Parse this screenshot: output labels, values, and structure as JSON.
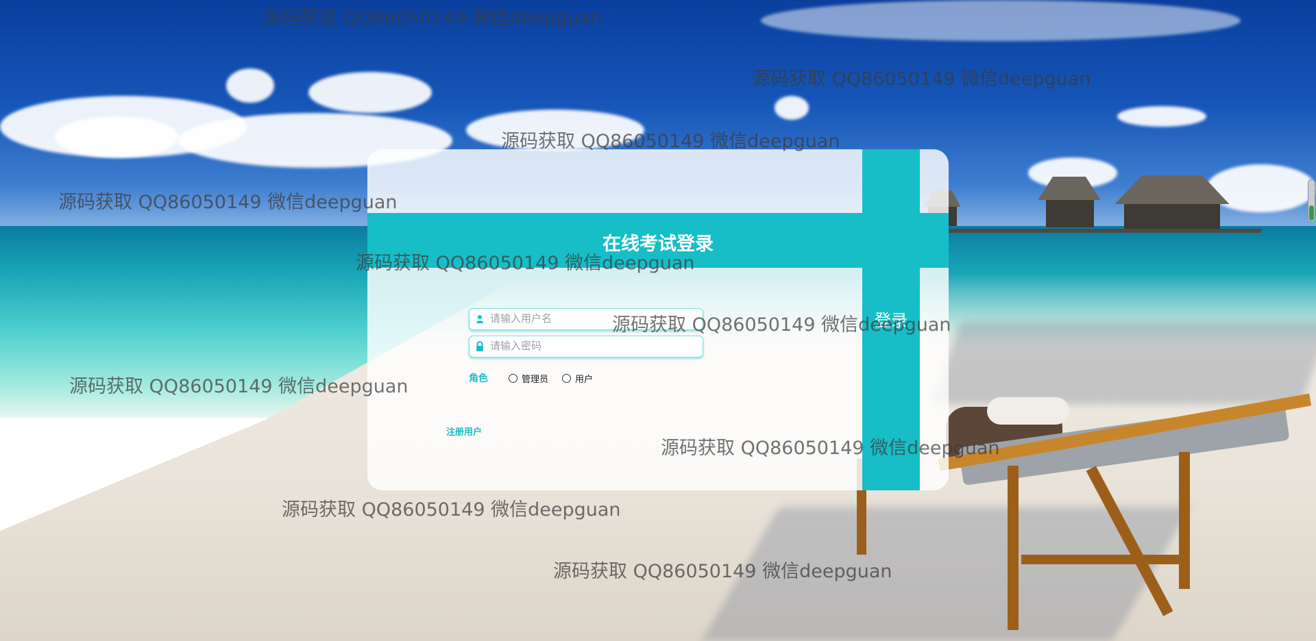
{
  "login": {
    "title": "在线考试登录",
    "submit_label": "登录",
    "username_placeholder": "请输入用户名",
    "password_placeholder": "请输入密码",
    "role_label": "角色",
    "roles": [
      "管理员",
      "用户"
    ],
    "register_label": "注册用户"
  },
  "watermark": {
    "text": "源码获取 QQ86050149 微信deepguan"
  },
  "colors": {
    "accent": "#17bec7",
    "watermark": "#3c3c3c"
  },
  "icons": {
    "username": "user-icon",
    "password": "lock-icon"
  }
}
